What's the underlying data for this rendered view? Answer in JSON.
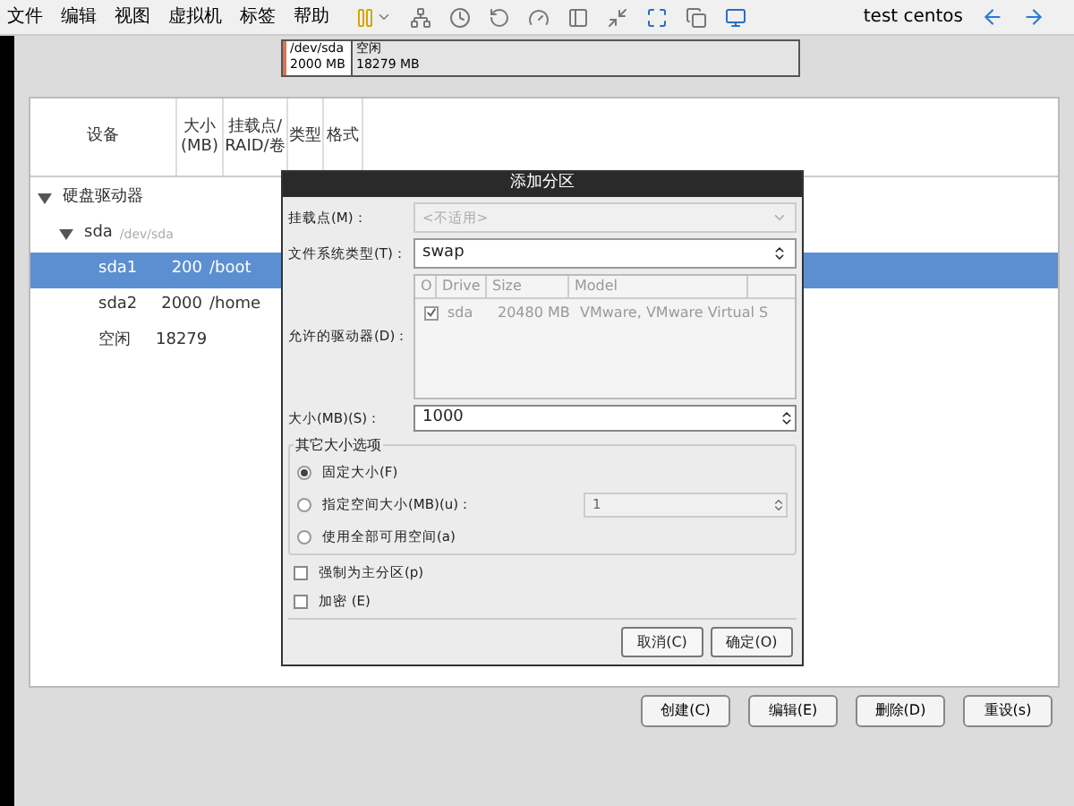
{
  "menu": {
    "items": [
      "文件",
      "编辑",
      "视图",
      "虚拟机",
      "标签",
      "帮助"
    ],
    "vm_name": "test centos"
  },
  "disk_bar": {
    "segments": [
      {
        "label": "/dev/sda",
        "size": "2000 MB",
        "selected": true
      },
      {
        "label": "空闲",
        "size": "18279 MB",
        "selected": false
      }
    ]
  },
  "table": {
    "columns": [
      [
        "设备"
      ],
      [
        "大小",
        "(MB)"
      ],
      [
        "挂载点/",
        "RAID/卷"
      ],
      [
        "类型"
      ],
      [
        "格式"
      ]
    ],
    "tree": [
      {
        "name": "硬盘驱动器",
        "expanded": true,
        "children": [
          {
            "name": "sda",
            "detail": "/dev/sda",
            "expanded": true,
            "children": [
              {
                "name": "sda1",
                "size": "200",
                "mount": "/boot",
                "selected": true
              },
              {
                "name": "sda2",
                "size": "2000",
                "mount": "/home",
                "selected": false
              },
              {
                "name": "空闲",
                "size": "18279",
                "selected": false
              }
            ]
          }
        ]
      }
    ]
  },
  "dialog": {
    "title": "添加分区",
    "mount_point": {
      "label": "挂载点(M)：",
      "value": "<不适用>",
      "disabled": true
    },
    "fs_type": {
      "label": "文件系统类型(T)：",
      "value": "swap"
    },
    "drives": {
      "label": "允许的驱动器(D)：",
      "columns": [
        "O",
        "Drive",
        "Size",
        "Model"
      ],
      "rows": [
        {
          "checked": true,
          "drive": "sda",
          "size": "20480 MB",
          "model": "VMware, VMware Virtual S"
        }
      ]
    },
    "size": {
      "label": "大小(MB)(S)：",
      "value": "1000"
    },
    "options": {
      "title": "其它大小选项",
      "items": [
        {
          "label": "固定大小(F)",
          "selected": true
        },
        {
          "label": "指定空间大小(MB)(u)：",
          "selected": false,
          "value": "1"
        },
        {
          "label": "使用全部可用空间(a)",
          "selected": false
        }
      ]
    },
    "checks": [
      {
        "label": "强制为主分区(p)",
        "checked": false
      },
      {
        "label": "加密 (E)",
        "checked": false
      }
    ],
    "buttons": [
      "取消(C)",
      "确定(O)"
    ]
  },
  "bottom_buttons": [
    "创建(C)",
    "编辑(E)",
    "删除(D)",
    "重设(s)"
  ]
}
